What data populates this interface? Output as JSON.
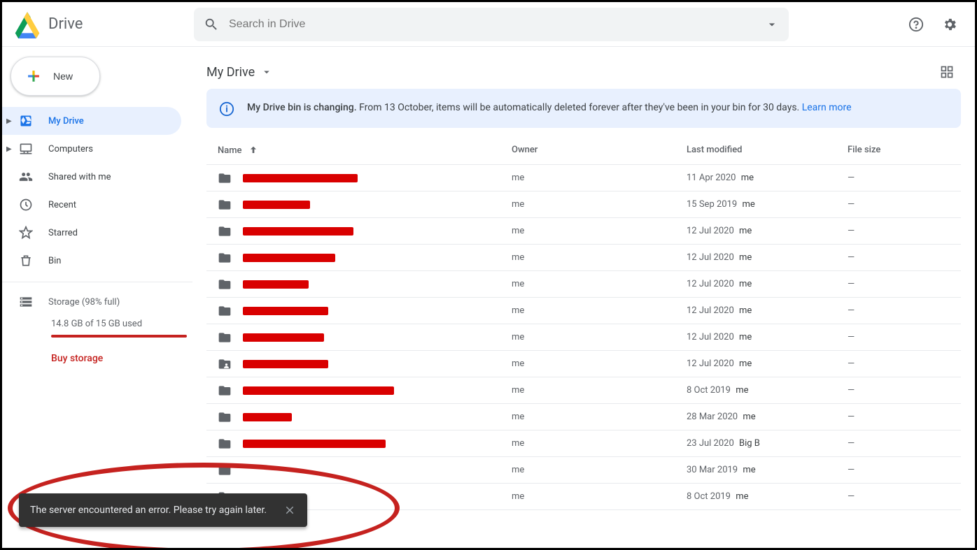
{
  "app": {
    "title": "Drive"
  },
  "search": {
    "placeholder": "Search in Drive"
  },
  "newButton": {
    "label": "New"
  },
  "sidebar": {
    "items": [
      {
        "label": "My Drive"
      },
      {
        "label": "Computers"
      },
      {
        "label": "Shared with me"
      },
      {
        "label": "Recent"
      },
      {
        "label": "Starred"
      },
      {
        "label": "Bin"
      }
    ],
    "storage": {
      "label": "Storage (98% full)",
      "used": "14.8 GB of 15 GB used",
      "buy": "Buy storage"
    }
  },
  "path": {
    "label": "My Drive"
  },
  "banner": {
    "bold": "My Drive bin is changing.",
    "rest": "From 13 October, items will be automatically deleted forever after they've been in your bin for 30 days.",
    "learnMore": "Learn more"
  },
  "columns": {
    "name": "Name",
    "owner": "Owner",
    "modified": "Last modified",
    "size": "File size"
  },
  "rows": [
    {
      "owner": "me",
      "date": "11 Apr 2020",
      "by": "me",
      "size": "—",
      "redactW": 164,
      "icon": "folder"
    },
    {
      "owner": "me",
      "date": "15 Sep 2019",
      "by": "me",
      "size": "—",
      "redactW": 96,
      "icon": "folder"
    },
    {
      "owner": "me",
      "date": "12 Jul 2020",
      "by": "me",
      "size": "—",
      "redactW": 158,
      "icon": "folder"
    },
    {
      "owner": "me",
      "date": "12 Jul 2020",
      "by": "me",
      "size": "—",
      "redactW": 132,
      "icon": "folder"
    },
    {
      "owner": "me",
      "date": "12 Jul 2020",
      "by": "me",
      "size": "—",
      "redactW": 94,
      "icon": "folder"
    },
    {
      "owner": "me",
      "date": "12 Jul 2020",
      "by": "me",
      "size": "—",
      "redactW": 122,
      "icon": "folder"
    },
    {
      "owner": "me",
      "date": "12 Jul 2020",
      "by": "me",
      "size": "—",
      "redactW": 116,
      "icon": "folder"
    },
    {
      "owner": "me",
      "date": "12 Jul 2020",
      "by": "me",
      "size": "—",
      "redactW": 122,
      "icon": "folder-shared"
    },
    {
      "owner": "me",
      "date": "8 Oct 2019",
      "by": "me",
      "size": "—",
      "redactW": 216,
      "icon": "folder"
    },
    {
      "owner": "me",
      "date": "28 Mar 2020",
      "by": "me",
      "size": "—",
      "redactW": 70,
      "icon": "folder"
    },
    {
      "owner": "me",
      "date": "23 Jul 2020",
      "by": "Big B",
      "size": "—",
      "redactW": 204,
      "icon": "folder"
    },
    {
      "owner": "me",
      "date": "30 Mar 2019",
      "by": "me",
      "size": "—",
      "redactW": 0,
      "icon": "folder"
    },
    {
      "owner": "me",
      "date": "8 Oct 2019",
      "by": "me",
      "size": "—",
      "redactW": 0,
      "icon": "folder"
    }
  ],
  "toast": {
    "text": "The server encountered an error. Please try again later."
  }
}
